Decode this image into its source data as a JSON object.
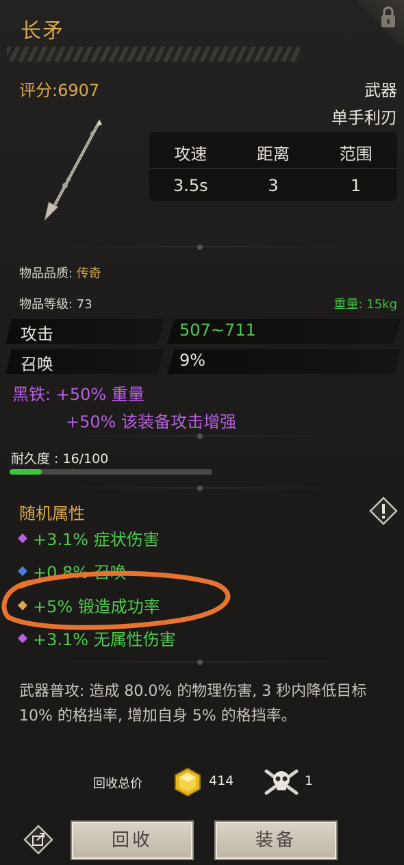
{
  "item": {
    "name": "长矛",
    "score": "评分:6907",
    "category": "武器",
    "subcategory": "单手利刃",
    "icon": "spear-icon"
  },
  "stat_table": {
    "headers": [
      "攻速",
      "距离",
      "范围"
    ],
    "values": [
      "3.5s",
      "3",
      "1"
    ]
  },
  "quality": {
    "label": "物品品质:",
    "value": "传奇",
    "color": "#d9a94a"
  },
  "level": {
    "text": "物品等级: 73"
  },
  "weight": {
    "text": "重量: 15kg"
  },
  "attributes": [
    {
      "name": "攻击",
      "value": "507~711",
      "color": "#4ec94e"
    },
    {
      "name": "召唤",
      "value": "9%",
      "color": "#e8e4dc"
    }
  ],
  "material": {
    "line1": "黑铁: +50% 重量",
    "line2": "+50% 该装备攻击增强",
    "color": "#b85fe3"
  },
  "durability": {
    "label": "耐久度 : 16/100",
    "current": 16,
    "max": 100
  },
  "random_attrs": {
    "title": "随机属性",
    "items": [
      {
        "text": "+3.1% 症状伤害",
        "gem_color": "#b85fe3"
      },
      {
        "text": "+0.8% 召唤",
        "gem_color": "#4a7fe0"
      },
      {
        "text": "+5% 锻造成功率",
        "gem_color": "#d9a94a"
      },
      {
        "text": "+3.1% 无属性伤害",
        "gem_color": "#b85fe3"
      }
    ]
  },
  "description": "武器普攻: 造成 80.0% 的物理伤害, 3 秒内降低目标 10% 的格挡率, 增加自身 5% 的格挡率。",
  "recycle": {
    "label": "回收总价",
    "gold": "414",
    "skull": "1"
  },
  "buttons": {
    "recycle": "回收",
    "equip": "装备"
  },
  "colors": {
    "accent_gold": "#d9a94a",
    "green": "#4ec94e",
    "purple": "#b85fe3",
    "annotation": "#e8732e"
  }
}
